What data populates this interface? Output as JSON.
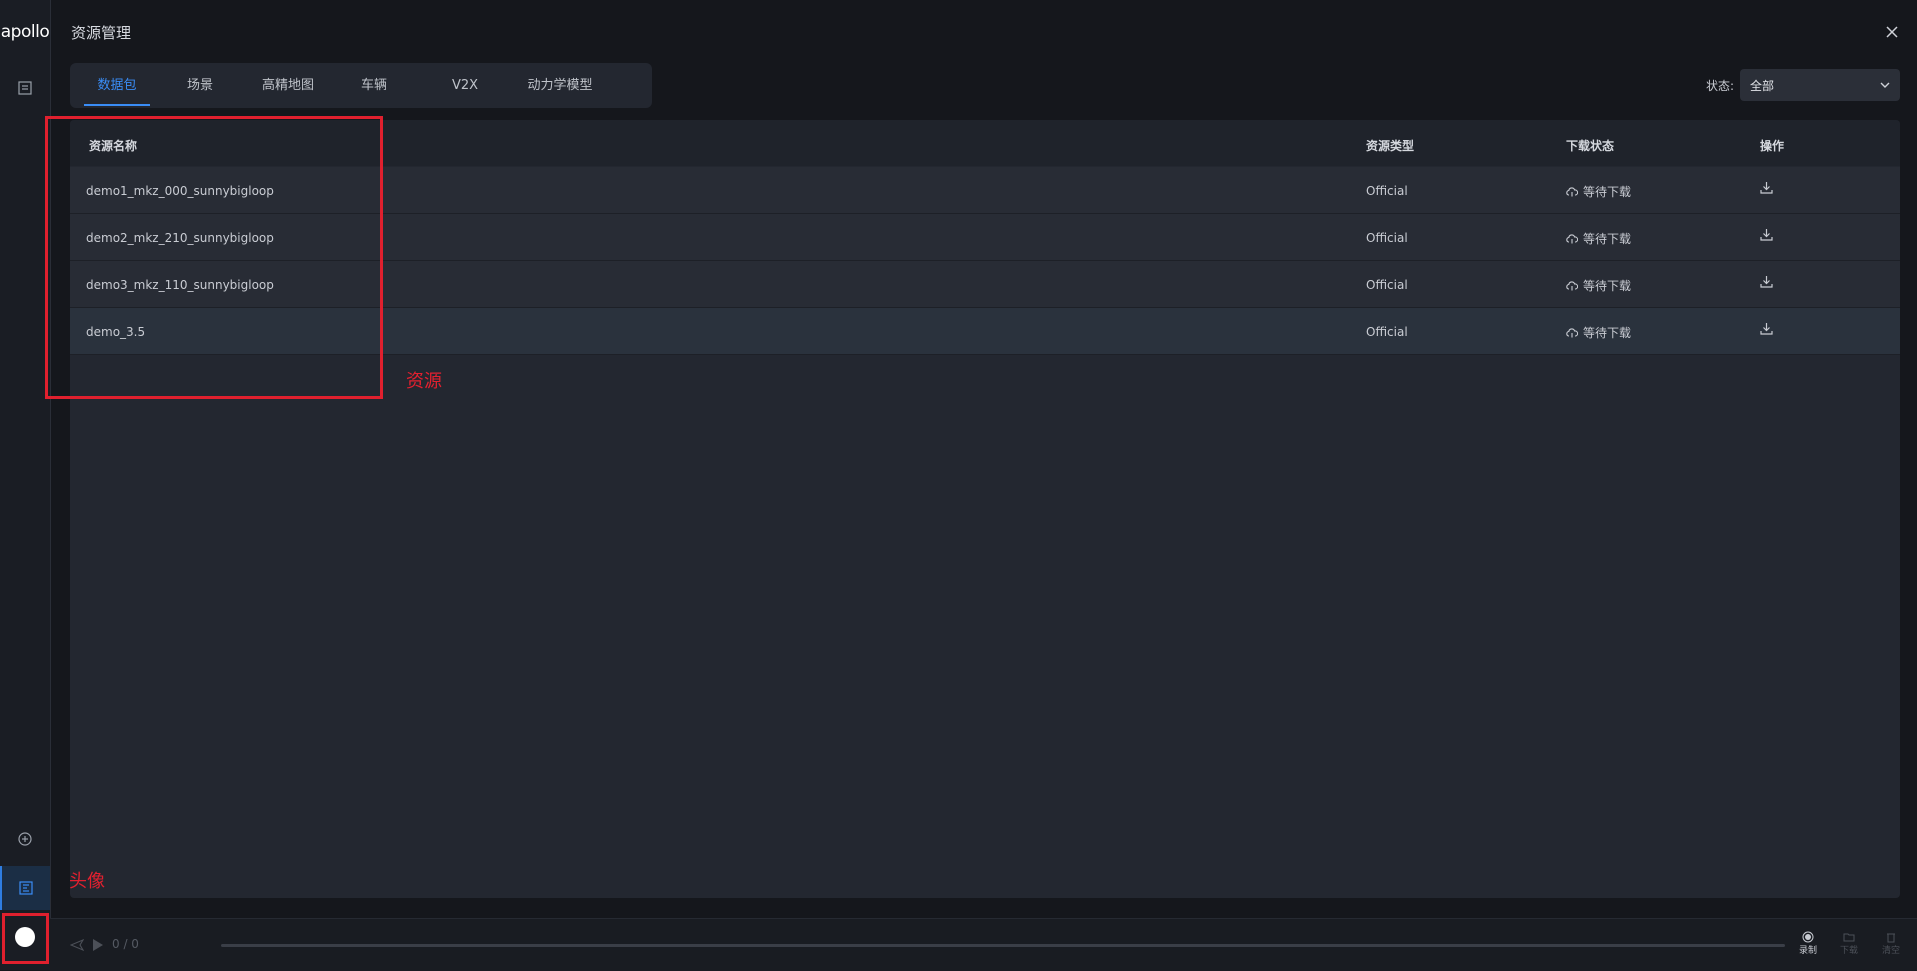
{
  "app": {
    "logo_text": "apollo"
  },
  "header": {
    "title": "资源管理"
  },
  "tabs": [
    {
      "label": "数据包",
      "active": true
    },
    {
      "label": "场景",
      "active": false
    },
    {
      "label": "高精地图",
      "active": false
    },
    {
      "label": "车辆",
      "active": false
    },
    {
      "label": "V2X",
      "active": false
    },
    {
      "label": "动力学模型",
      "active": false
    }
  ],
  "filter": {
    "label": "状态:",
    "value": "全部"
  },
  "table": {
    "headers": {
      "name": "资源名称",
      "type": "资源类型",
      "status": "下载状态",
      "op": "操作"
    },
    "rows": [
      {
        "name": "demo1_mkz_000_sunnybigloop",
        "type": "Official",
        "status": "等待下载"
      },
      {
        "name": "demo2_mkz_210_sunnybigloop",
        "type": "Official",
        "status": "等待下载"
      },
      {
        "name": "demo3_mkz_110_sunnybigloop",
        "type": "Official",
        "status": "等待下载"
      },
      {
        "name": "demo_3.5",
        "type": "Official",
        "status": "等待下载"
      }
    ]
  },
  "annotations": {
    "resource": "资源",
    "avatar": "头像"
  },
  "player": {
    "counter": "0 / 0",
    "record_label": "录制",
    "download_label": "下载",
    "clear_label": "清空"
  },
  "colors": {
    "accent": "#3a8df6",
    "annotation": "#e0202e",
    "background": "#15171c"
  }
}
